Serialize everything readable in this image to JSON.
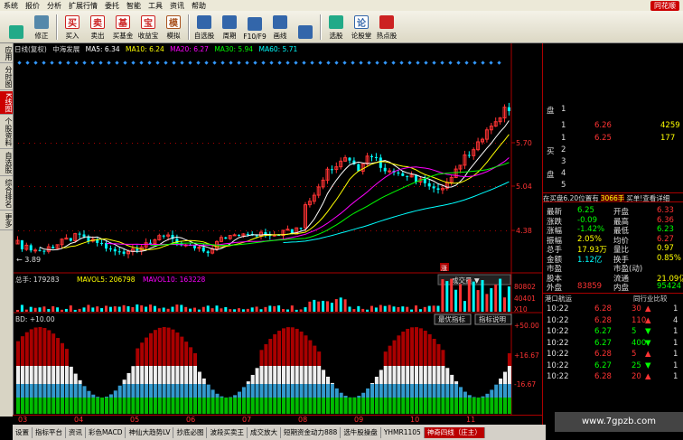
{
  "menubar": {
    "items": [
      "系统",
      "报价",
      "分析",
      "扩展行情",
      "委托",
      "智能",
      "工具",
      "资讯",
      "帮助"
    ],
    "logo": "同花顺"
  },
  "toolbar": {
    "buttons": [
      {
        "label": "",
        "icon": "back-arrow-icon"
      },
      {
        "label": "修正",
        "icon": "edit-icon"
      },
      {
        "label": "买入",
        "icon": "buy-icon",
        "glyph": "买"
      },
      {
        "label": "卖出",
        "icon": "sell-icon",
        "glyph": "卖"
      },
      {
        "label": "买基金",
        "icon": "fund-icon",
        "glyph": "基"
      },
      {
        "label": "收益宝",
        "icon": "treasure-icon",
        "glyph": "宝"
      },
      {
        "label": "模拟",
        "icon": "hammer-icon",
        "glyph": "模"
      },
      {
        "label": "自选股",
        "icon": "watchlist-icon"
      },
      {
        "label": "周期",
        "icon": "period-icon"
      },
      {
        "label": "F10/F9",
        "icon": "f10-icon"
      },
      {
        "label": "画线",
        "icon": "drawline-icon"
      },
      {
        "label": "",
        "icon": "zoom-icon"
      },
      {
        "label": "选股",
        "icon": "stockpicker-icon"
      },
      {
        "label": "论股堂",
        "icon": "forum-icon",
        "glyph": "论"
      },
      {
        "label": "热点股",
        "icon": "hot-icon"
      }
    ]
  },
  "lefttabs": [
    "应用",
    "分时图",
    "K线图",
    "个股资料",
    "自选股",
    "综合排名",
    "更多"
  ],
  "chart": {
    "title": "日线(复权)",
    "stock": "中海发展",
    "ma5": "MA5: 6.34",
    "ma10": "MA10: 6.24",
    "ma20": "MA20: 6.27",
    "ma30": "MA30: 5.94",
    "ma60": "MA60: 5.71",
    "price_ticks": [
      "5.70",
      "5.04",
      "4.38"
    ],
    "low_label": "3.89",
    "zhang_label": "涨",
    "volume": {
      "total": "总手: 179283",
      "mavol5": "MAVOL5: 206798",
      "mavol10": "MAVOL10: 163228",
      "dropdown": "成交量",
      "ticks": [
        "80802",
        "40401",
        "X10"
      ]
    },
    "indicator": {
      "label": "BD: +10.00",
      "btn_best": "最优指标",
      "btn_desc": "指标说明",
      "ticks": [
        "+50.00",
        "+16.67",
        "-16.67"
      ]
    },
    "date_ticks": [
      "03",
      "04",
      "05",
      "06",
      "07",
      "08",
      "09",
      "10",
      "11"
    ]
  },
  "bottomtabs": [
    "设置",
    "指标平台",
    "资讯",
    "彩色MACD",
    "神仙大趋势LV",
    "抄底必图",
    "波段买卖王",
    "成交放大",
    "短期资金动力888",
    "选牛股操盘",
    "YHMR1105",
    "神奇四线（庄主）"
  ],
  "quote": {
    "sell": [
      {
        "label": "盘",
        "level": "1",
        "price": "",
        "vol": ""
      },
      {
        "label": "",
        "level": "1",
        "price": "6.26",
        "vol": "4259"
      },
      {
        "label": "",
        "level": "1",
        "price": "6.25",
        "vol": "177"
      }
    ],
    "buy_label_1": "买",
    "buy_label_2": "盘",
    "buy_levels": [
      "2",
      "3",
      "4",
      "5"
    ],
    "buy_header": "在买盘6.20位置有",
    "buy_header_vol": "3066手",
    "buy_header_link": "买单!查看详细",
    "stats": [
      {
        "k1": "最新",
        "v1": "6.25",
        "k2": "开盘",
        "v2": "6.33",
        "c1": "#0f0",
        "c2": "#f33"
      },
      {
        "k1": "涨跌",
        "v1": "-0.09",
        "k2": "最高",
        "v2": "6.36",
        "c1": "#0f0",
        "c2": "#f33"
      },
      {
        "k1": "涨幅",
        "v1": "-1.42%",
        "k2": "最低",
        "v2": "6.23",
        "c1": "#0f0",
        "c2": "#0f0"
      },
      {
        "k1": "振幅",
        "v1": "2.05%",
        "k2": "均价",
        "v2": "6.27",
        "c1": "#ff0",
        "c2": "#f33"
      },
      {
        "k1": "总手",
        "v1": "17.93万",
        "k2": "量比",
        "v2": "0.97",
        "c1": "#ff0",
        "c2": "#ff0"
      },
      {
        "k1": "金额",
        "v1": "1.12亿",
        "k2": "换手",
        "v2": "0.85%",
        "c1": "#0ff",
        "c2": "#ff0"
      },
      {
        "k1": "市盈",
        "v1": "",
        "k2": "市盈(动)",
        "v2": "",
        "c1": "#fff",
        "c2": "#fff"
      },
      {
        "k1": "股本",
        "v1": "",
        "k2": "流通",
        "v2": "21.09亿",
        "c1": "#ff0",
        "c2": "#ff0"
      },
      {
        "k1": "外盘",
        "v1": "83859",
        "k2": "内盘",
        "v2": "95424",
        "c1": "#f33",
        "c2": "#0f0"
      }
    ],
    "sector_tab": "港口航运",
    "sector_link": "同行业比较",
    "ticks": [
      {
        "time": "10:22",
        "price": "6.28",
        "vol": "30",
        "dir": "up",
        "n": "1"
      },
      {
        "time": "10:22",
        "price": "6.28",
        "vol": "110",
        "dir": "up",
        "n": "4"
      },
      {
        "time": "10:22",
        "price": "6.27",
        "vol": "5",
        "dir": "down",
        "n": "1"
      },
      {
        "time": "10:22",
        "price": "6.27",
        "vol": "400",
        "dir": "down",
        "n": "1"
      },
      {
        "time": "10:22",
        "price": "6.28",
        "vol": "5",
        "dir": "up",
        "n": "1"
      },
      {
        "time": "10:22",
        "price": "6.27",
        "vol": "25",
        "dir": "down",
        "n": "1"
      },
      {
        "time": "10:22",
        "price": "6.28",
        "vol": "20",
        "dir": "up",
        "n": "1"
      }
    ]
  },
  "watermark": "www.7gpzb.com"
}
